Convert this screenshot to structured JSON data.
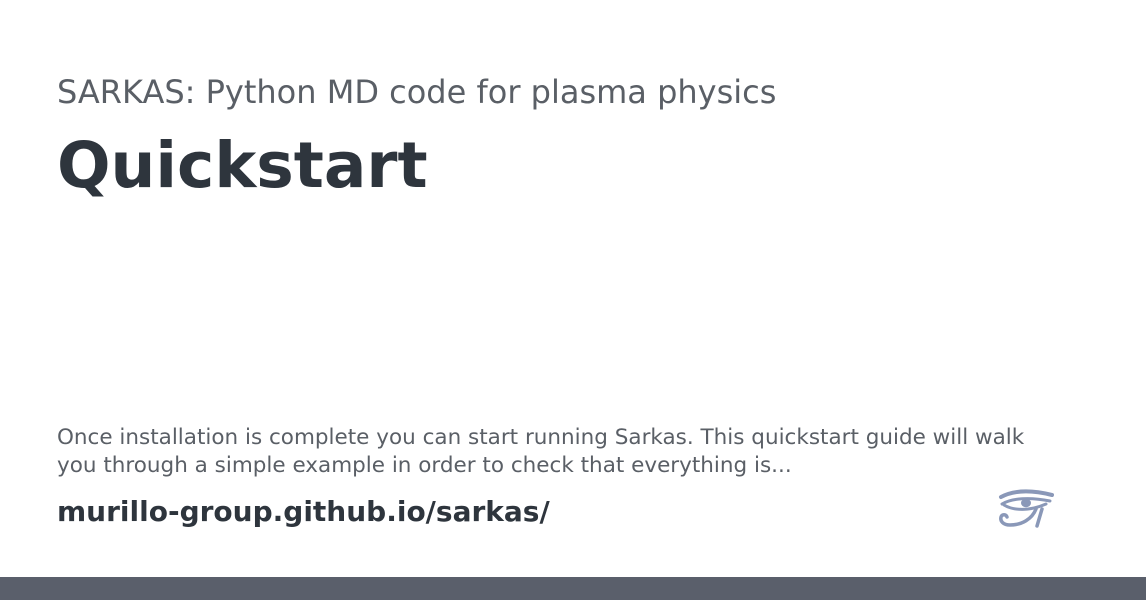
{
  "card": {
    "site_title": "SARKAS: Python MD code for plasma physics",
    "page_title": "Quickstart",
    "description": "Once installation is complete you can start running Sarkas. This quickstart guide will walk you through a simple example in order to check that everything is...",
    "site_url": "murillo-group.github.io/sarkas/",
    "logo_icon": "eye-of-horus-icon"
  },
  "colors": {
    "title_dark": "#2e353d",
    "text_muted": "#5a5f66",
    "logo": "#8a98b8",
    "footer_bar": "#5a5f6b",
    "background": "#ffffff"
  }
}
